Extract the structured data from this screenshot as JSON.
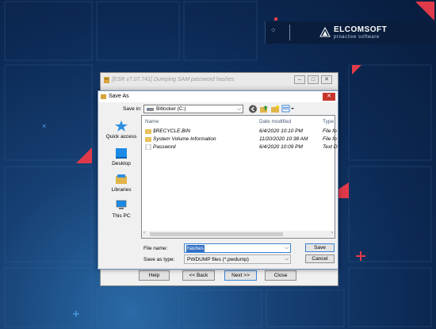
{
  "brand": {
    "name": "ELCOMSOFT",
    "tagline": "proactive software"
  },
  "back_window": {
    "title": "[ESR v7.07.741] Dumping SAM password hashes",
    "controls": {
      "minimize": "–",
      "maximize": "□",
      "close": "✕"
    },
    "buttons": {
      "help": "Help",
      "back": "<< Back",
      "next": "Next >>",
      "close": "Close"
    }
  },
  "dialog": {
    "title": "Save As",
    "close_glyph": "✕",
    "save_in_label": "Save in:",
    "save_in_value": "Bitlocker (C:)",
    "places": [
      {
        "label": "Quick access"
      },
      {
        "label": "Desktop"
      },
      {
        "label": "Libraries"
      },
      {
        "label": "This PC"
      }
    ],
    "columns": {
      "name": "Name",
      "date": "Date modified",
      "type": "Type"
    },
    "files": [
      {
        "name": "$RECYCLE.BIN",
        "date": "6/4/2020 10:10 PM",
        "type": "File fo"
      },
      {
        "name": "System Volume Information",
        "date": "11/20/2020 10:38 AM",
        "type": "File fo"
      },
      {
        "name": "Password",
        "date": "6/4/2020 10:09 PM",
        "type": "Text D"
      }
    ],
    "file_name_label": "File name:",
    "file_name_value": "hashes",
    "save_type_label": "Save as type:",
    "save_type_value": "PWDUMP files (*.pwdump)",
    "save_button": "Save",
    "cancel_button": "Cancel"
  },
  "colors": {
    "accent": "#3a84d8",
    "close_red": "#c7362b",
    "bg_dark": "#0c2a55"
  }
}
